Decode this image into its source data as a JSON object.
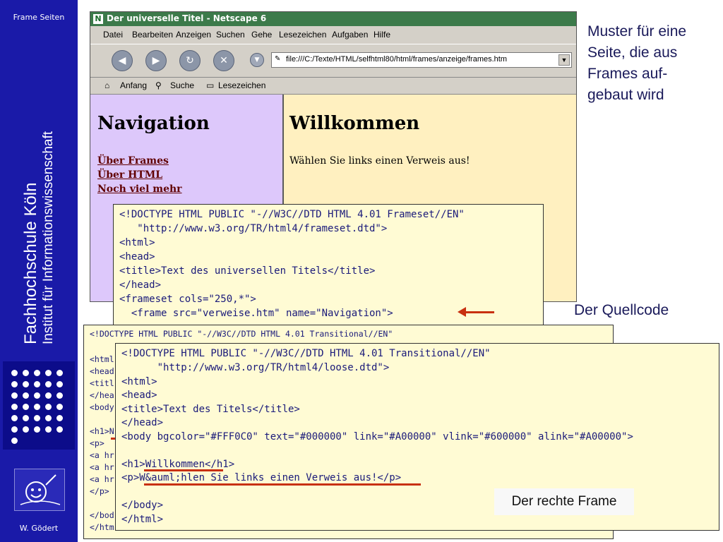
{
  "sidebar": {
    "top_label": "Frame Seiten",
    "institution_line1": "Fachhochschule Köln",
    "institution_line2": "Institut für Informationswissenschaft",
    "author": "W. Gödert"
  },
  "browser": {
    "title": "Der universelle Titel - Netscape 6",
    "menu": [
      "Datei",
      "Bearbeiten",
      "Anzeigen",
      "Suchen",
      "Gehe",
      "Lesezeichen",
      "Aufgaben",
      "Hilfe"
    ],
    "url": "file:///C:/Texte/HTML/selfhtml80/html/frames/anzeige/frames.htm",
    "personal_bar": [
      "Anfang",
      "Suche",
      "Lesezeichen"
    ],
    "left_frame": {
      "heading": "Navigation",
      "links": [
        "Über Frames",
        "Über HTML",
        "Noch viel mehr"
      ]
    },
    "right_frame": {
      "heading": "Willkommen",
      "text": "Wählen Sie links einen Verweis aus!"
    }
  },
  "captions": {
    "pattern_line1": "Muster für eine",
    "pattern_line2": "Seite, die aus",
    "pattern_line3": "Frames auf-",
    "pattern_line4": "gebaut wird",
    "source_code": "Der Quellcode",
    "right_frame": "Der rechte Frame"
  },
  "code_frameset": [
    "<!DOCTYPE HTML PUBLIC \"-//W3C//DTD HTML 4.01 Frameset//EN\"",
    "   \"http://www.w3.org/TR/html4/frameset.dtd\">",
    "<html>",
    "<head>",
    "<title>Text des universellen Titels</title>",
    "</head>",
    "<frameset cols=\"250,*\">",
    "  <frame src=\"verweise.htm\" name=\"Navigation\">"
  ],
  "code_navigation": [
    "<!DOCTYPE HTML PUBLIC \"-//W3C//DTD HTML 4.01 Transitional//EN\"",
    "",
    "<html",
    "<head",
    "<titl",
    "</hea",
    "<body",
    "",
    "<h1>N",
    "<p>",
    "<a hr",
    "<a hr",
    "<a hr",
    "</p>",
    "",
    "</bod",
    "</htm"
  ],
  "code_right": [
    "<!DOCTYPE HTML PUBLIC \"-//W3C//DTD HTML 4.01 Transitional//EN\"",
    "      \"http://www.w3.org/TR/html4/loose.dtd\">",
    "<html>",
    "<head>",
    "<title>Text des Titels</title>",
    "</head>",
    "<body bgcolor=\"#FFF0C0\" text=\"#000000\" link=\"#A00000\" vlink=\"#600000\" alink=\"#A00000\">",
    "",
    "<h1>Willkommen</h1>",
    "<p>W&auml;hlen Sie links einen Verweis aus!</p>",
    "",
    "</body>",
    "</html>"
  ]
}
